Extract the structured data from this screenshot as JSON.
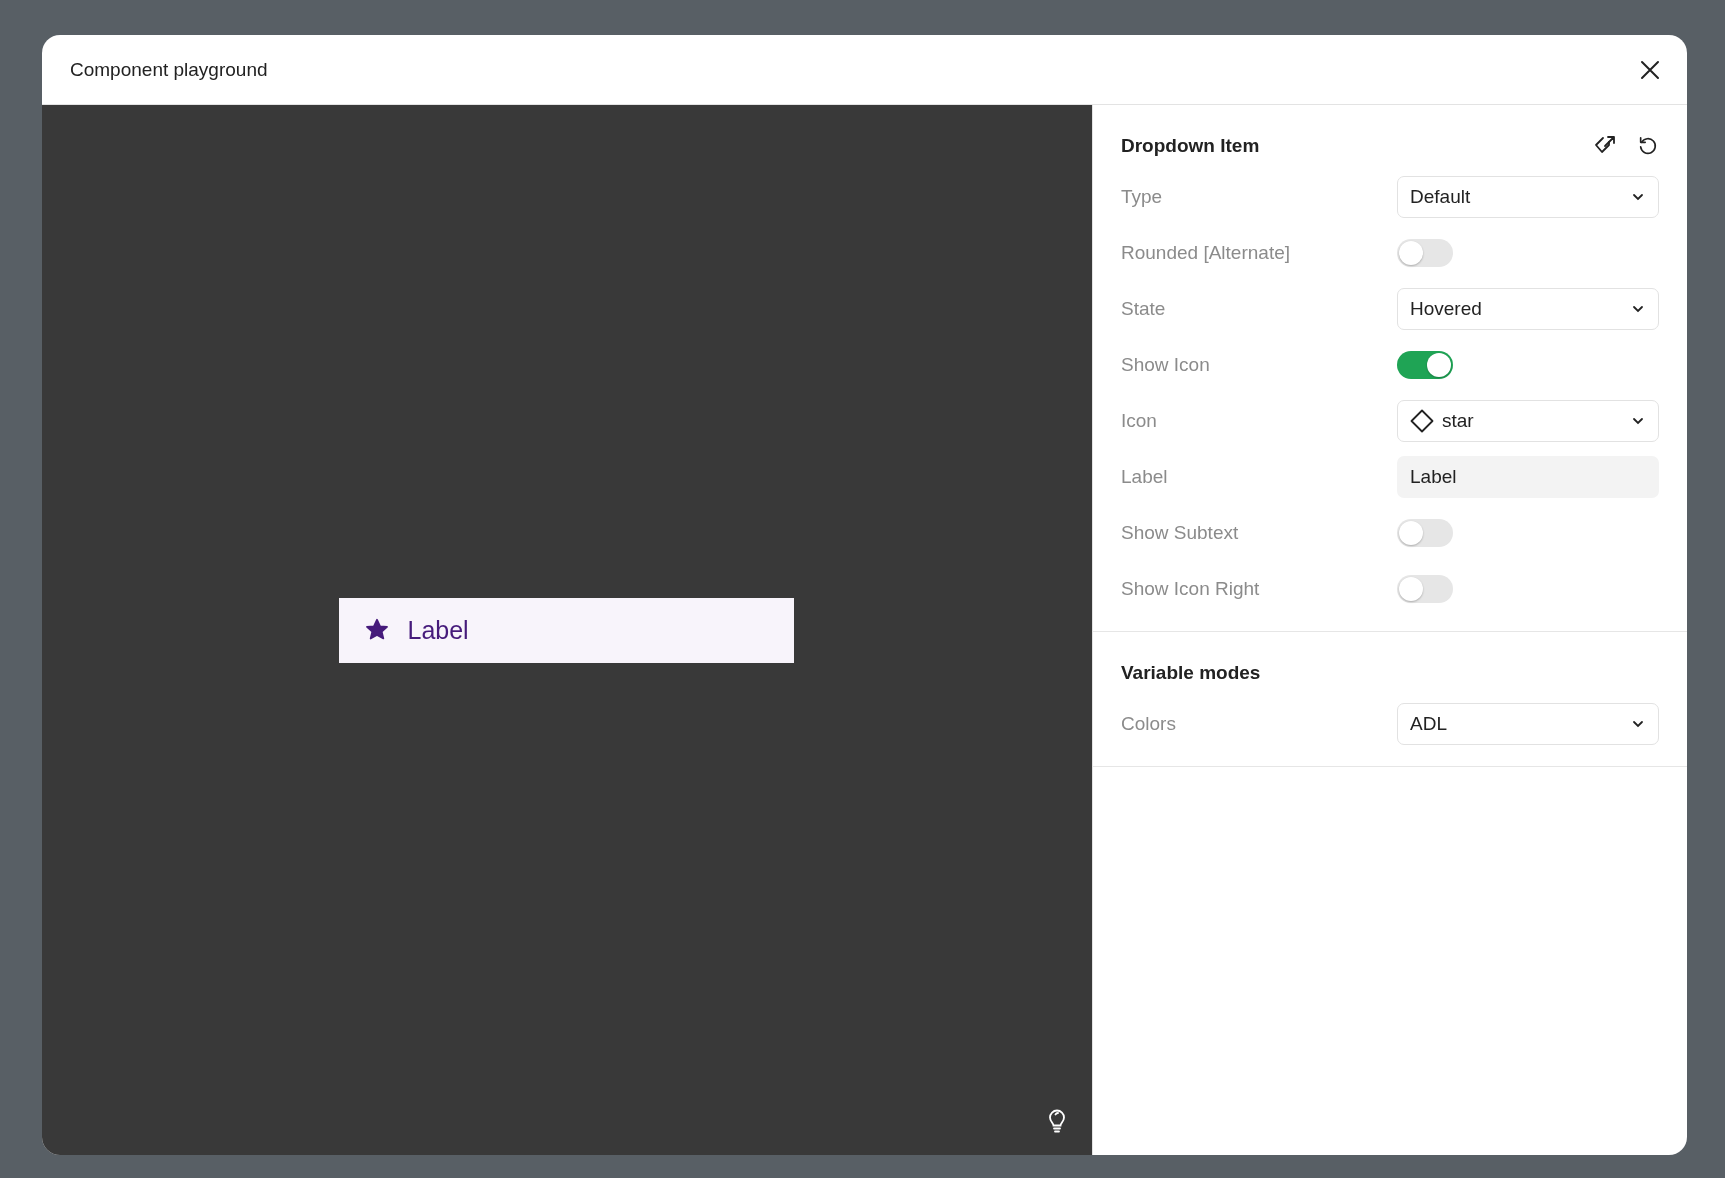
{
  "dialog": {
    "title": "Component playground"
  },
  "preview": {
    "label": "Label"
  },
  "panel": {
    "title": "Dropdown Item",
    "properties": [
      {
        "kind": "select",
        "label": "Type",
        "value": "Default"
      },
      {
        "kind": "toggle",
        "label": "Rounded [Alternate]",
        "on": false
      },
      {
        "kind": "select",
        "label": "State",
        "value": "Hovered"
      },
      {
        "kind": "toggle",
        "label": "Show Icon",
        "on": true
      },
      {
        "kind": "icon-select",
        "label": "Icon",
        "value": "star"
      },
      {
        "kind": "text",
        "label": "Label",
        "value": "Label"
      },
      {
        "kind": "toggle",
        "label": "Show Subtext",
        "on": false
      },
      {
        "kind": "toggle",
        "label": "Show Icon Right",
        "on": false
      }
    ]
  },
  "variable_modes": {
    "title": "Variable modes",
    "properties": [
      {
        "kind": "select",
        "label": "Colors",
        "value": "ADL"
      }
    ]
  }
}
